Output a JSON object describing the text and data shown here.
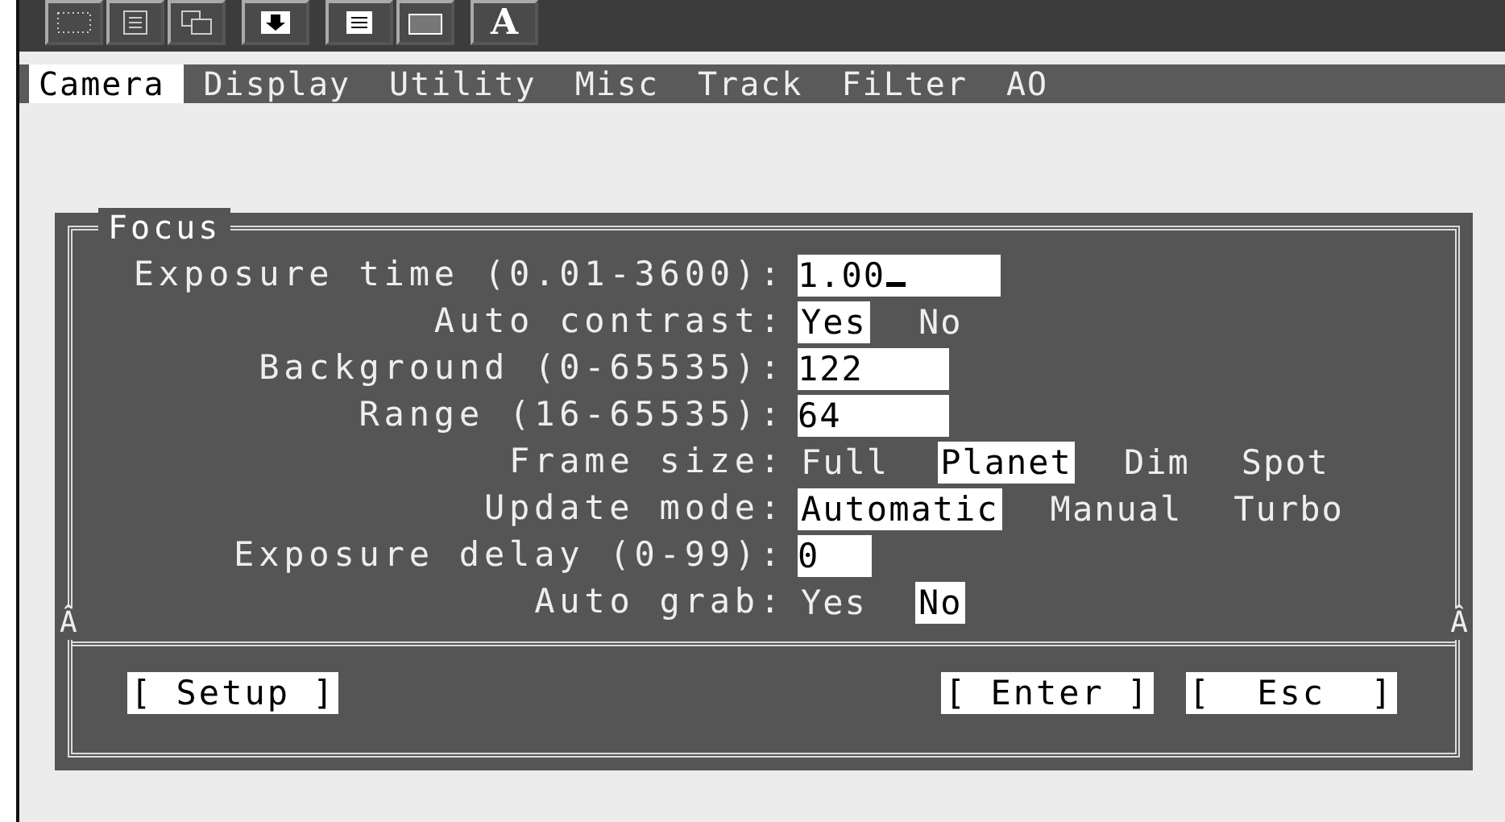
{
  "toolbar": {
    "buttons": [
      {
        "kind": "dots"
      },
      {
        "kind": "list"
      },
      {
        "kind": "copy"
      },
      {
        "kind": "download"
      },
      {
        "kind": "doc"
      },
      {
        "kind": "frame"
      },
      {
        "kind": "font",
        "label": "A"
      }
    ]
  },
  "menu": [
    {
      "label": "Camera",
      "selected": true
    },
    {
      "label": "Display",
      "selected": false
    },
    {
      "label": "Utility",
      "selected": false
    },
    {
      "label": "Misc",
      "selected": false
    },
    {
      "label": "Track",
      "selected": false
    },
    {
      "label": "FiLter",
      "selected": false
    },
    {
      "label": "AO",
      "selected": false
    }
  ],
  "dialog": {
    "title": "Focus",
    "fields": [
      {
        "kind": "text",
        "label": "Exposure time (0.01-3600):",
        "value": "1.00",
        "cursor": true
      },
      {
        "kind": "choice",
        "label": "Auto contrast:",
        "options": [
          {
            "label": "Yes",
            "selected": true
          },
          {
            "label": "No",
            "selected": false
          }
        ]
      },
      {
        "kind": "text",
        "label": "Background (0-65535):",
        "value": "122",
        "cursor": false
      },
      {
        "kind": "text",
        "label": "Range (16-65535):",
        "value": "64",
        "cursor": false
      },
      {
        "kind": "choice",
        "label": "Frame size:",
        "options": [
          {
            "label": "Full",
            "selected": false
          },
          {
            "label": "Planet",
            "selected": true
          },
          {
            "label": "Dim",
            "selected": false
          },
          {
            "label": "Spot",
            "selected": false
          }
        ]
      },
      {
        "kind": "choice",
        "label": "Update mode:",
        "options": [
          {
            "label": "Automatic",
            "selected": true
          },
          {
            "label": "Manual",
            "selected": false
          },
          {
            "label": "Turbo",
            "selected": false
          }
        ]
      },
      {
        "kind": "text",
        "label": "Exposure delay (0-99):",
        "value": "0",
        "cursor": false
      },
      {
        "kind": "choice",
        "label": "Auto grab:",
        "options": [
          {
            "label": "Yes",
            "selected": false
          },
          {
            "label": "No",
            "selected": true
          }
        ]
      }
    ],
    "separator_marks": [
      "Â",
      "Â"
    ],
    "buttons": [
      {
        "label": "[ Setup ]"
      },
      {
        "label": "[ Enter ]"
      },
      {
        "label": "[  Esc  ]"
      }
    ]
  }
}
